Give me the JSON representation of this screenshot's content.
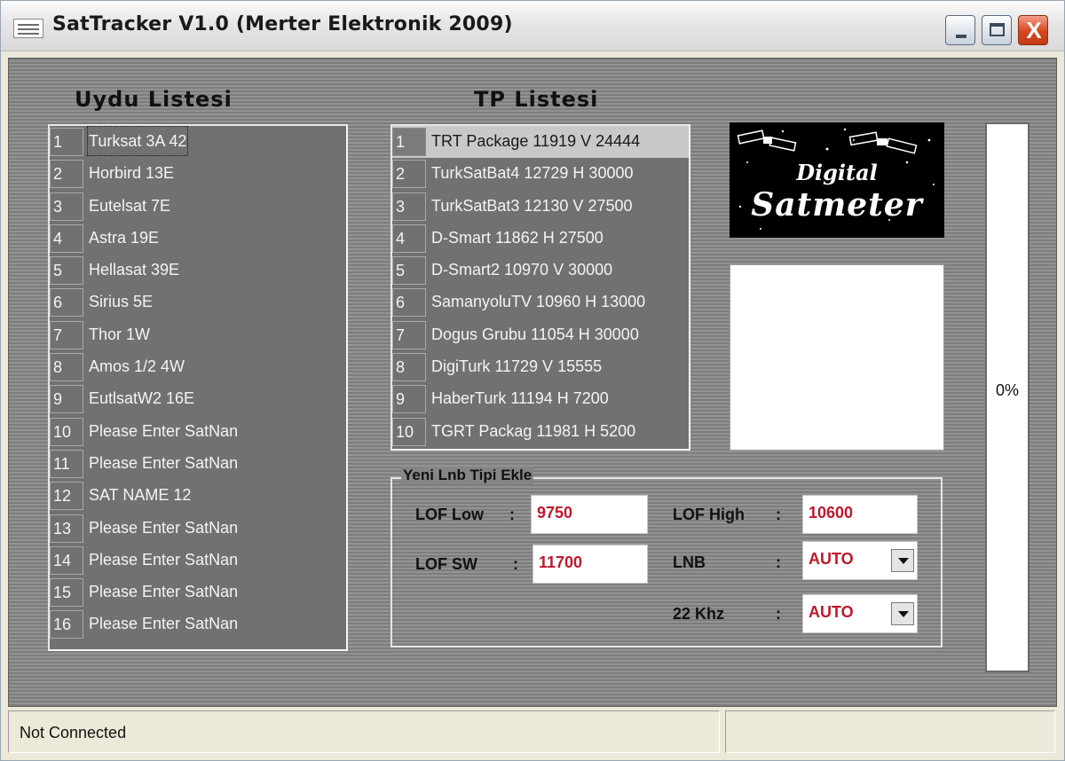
{
  "window": {
    "title": "SatTracker V1.0 (Merter Elektronik 2009)",
    "buttons": {
      "minimize": "minimize",
      "maximize": "maximize",
      "close": "X"
    }
  },
  "satellite_list": {
    "heading": "Uydu Listesi",
    "items": [
      {
        "num": "1",
        "name": "Turksat 3A 42"
      },
      {
        "num": "2",
        "name": "Horbird 13E"
      },
      {
        "num": "3",
        "name": "Eutelsat 7E"
      },
      {
        "num": "4",
        "name": "Astra 19E"
      },
      {
        "num": "5",
        "name": "Hellasat 39E"
      },
      {
        "num": "6",
        "name": "Sirius 5E"
      },
      {
        "num": "7",
        "name": "Thor 1W"
      },
      {
        "num": "8",
        "name": "Amos 1/2 4W"
      },
      {
        "num": "9",
        "name": "EutlsatW2 16E"
      },
      {
        "num": "10",
        "name": "Please Enter SatNan"
      },
      {
        "num": "11",
        "name": "Please Enter SatNan"
      },
      {
        "num": "12",
        "name": "SAT NAME 12"
      },
      {
        "num": "13",
        "name": "Please Enter SatNan"
      },
      {
        "num": "14",
        "name": "Please Enter SatNan"
      },
      {
        "num": "15",
        "name": "Please Enter SatNan"
      },
      {
        "num": "16",
        "name": "Please Enter SatNan"
      }
    ]
  },
  "tp_list": {
    "heading": "TP Listesi",
    "items": [
      {
        "num": "1",
        "name": "TRT Package 11919 V 24444"
      },
      {
        "num": "2",
        "name": "TurkSatBat4 12729 H 30000"
      },
      {
        "num": "3",
        "name": "TurkSatBat3 12130 V 27500"
      },
      {
        "num": "4",
        "name": "D-Smart 11862 H 27500"
      },
      {
        "num": "5",
        "name": "D-Smart2 10970 V 30000"
      },
      {
        "num": "6",
        "name": "SamanyoluTV 10960 H 13000"
      },
      {
        "num": "7",
        "name": "Dogus Grubu 11054 H 30000"
      },
      {
        "num": "8",
        "name": "DigiTurk 11729 V 15555"
      },
      {
        "num": "9",
        "name": "HaberTurk 11194 H 7200"
      },
      {
        "num": "10",
        "name": "TGRT Packag 11981 H 5200"
      }
    ]
  },
  "logo": {
    "line1": "Digital",
    "line2": "Satmeter"
  },
  "progress": {
    "label": "0%",
    "value": 0
  },
  "lnb_group": {
    "legend": "Yeni Lnb Tipi Ekle",
    "lof_low_label": "LOF Low",
    "lof_low_value": "9750",
    "lof_sw_label": "LOF SW",
    "lof_sw_value": "11700",
    "lof_high_label": "LOF High",
    "lof_high_value": "10600",
    "lnb_label": "LNB",
    "lnb_value": "AUTO",
    "khz_label": "22 Khz",
    "khz_value": "AUTO",
    "colon": ":"
  },
  "status": {
    "connection": "Not Connected",
    "secondary": ""
  }
}
